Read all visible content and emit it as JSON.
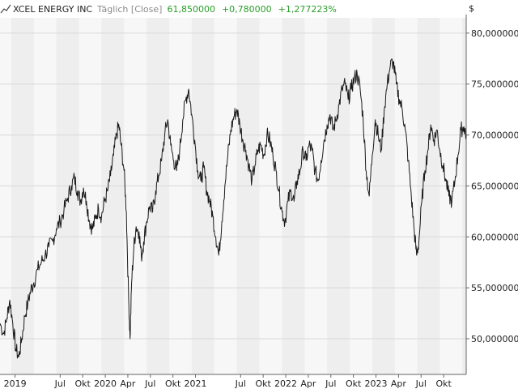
{
  "header": {
    "name": "XCEL ENERGY INC",
    "period": "Täglich [Close]",
    "last": "61,850000",
    "change": "+0,780000",
    "change_pct": "+1,277223%"
  },
  "colors": {
    "line": "#1a1a1a",
    "positive": "#2a9d2a",
    "band_light": "#f7f7f7",
    "band_dark": "#eeeeee",
    "grid": "#d8d8d8"
  },
  "chart_data": {
    "type": "line",
    "currency_label": "$",
    "y_ticks": [
      "80,000000",
      "75,000000",
      "70,000000",
      "65,000000",
      "60,000000",
      "55,000000",
      "50,000000"
    ],
    "y_tick_values": [
      80,
      75,
      70,
      65,
      60,
      55,
      50
    ],
    "ylim": [
      46.5,
      81.5
    ],
    "x_ticks": [
      {
        "label": "2019",
        "t": 0.5
      },
      {
        "label": "Jul",
        "t": 6.5
      },
      {
        "label": "Okt",
        "t": 9.5
      },
      {
        "label": "2020",
        "t": 12.5
      },
      {
        "label": "Apr",
        "t": 15.5
      },
      {
        "label": "Jul",
        "t": 18.5
      },
      {
        "label": "Okt",
        "t": 21.5
      },
      {
        "label": "2021",
        "t": 24.5
      },
      {
        "label": "Jul",
        "t": 30.5
      },
      {
        "label": "Okt",
        "t": 33.5
      },
      {
        "label": "2022",
        "t": 36.5
      },
      {
        "label": "Apr",
        "t": 39.5
      },
      {
        "label": "Jul",
        "t": 42.5
      },
      {
        "label": "Okt",
        "t": 45.5
      },
      {
        "label": "2023",
        "t": 48.5
      },
      {
        "label": "Apr",
        "t": 51.5
      },
      {
        "label": "Jul",
        "t": 54.5
      },
      {
        "label": "Okt",
        "t": 57.5
      }
    ],
    "xlim": [
      -1.5,
      60.5
    ],
    "series": [
      {
        "values": [
          [
            -1.5,
            51.5
          ],
          [
            -1.0,
            50.5
          ],
          [
            -0.6,
            52.0
          ],
          [
            -0.2,
            53.8
          ],
          [
            0.2,
            51.5
          ],
          [
            0.6,
            49.0
          ],
          [
            1.0,
            48.2
          ],
          [
            1.4,
            50.0
          ],
          [
            1.8,
            52.2
          ],
          [
            2.2,
            53.5
          ],
          [
            2.6,
            54.8
          ],
          [
            3.0,
            55.5
          ],
          [
            3.5,
            56.8
          ],
          [
            4.0,
            57.5
          ],
          [
            4.5,
            58.2
          ],
          [
            5.0,
            59.0
          ],
          [
            5.5,
            59.6
          ],
          [
            6.0,
            60.8
          ],
          [
            6.5,
            61.5
          ],
          [
            7.0,
            62.6
          ],
          [
            7.5,
            63.8
          ],
          [
            8.0,
            65.0
          ],
          [
            8.4,
            65.8
          ],
          [
            8.8,
            64.5
          ],
          [
            9.2,
            63.5
          ],
          [
            9.6,
            64.8
          ],
          [
            10.0,
            63.5
          ],
          [
            10.4,
            61.5
          ],
          [
            10.8,
            60.8
          ],
          [
            11.2,
            61.8
          ],
          [
            11.6,
            62.8
          ],
          [
            12.0,
            62.0
          ],
          [
            12.4,
            63.5
          ],
          [
            12.8,
            64.5
          ],
          [
            13.2,
            66.0
          ],
          [
            13.6,
            68.0
          ],
          [
            14.0,
            70.0
          ],
          [
            14.3,
            71.0
          ],
          [
            14.6,
            69.0
          ],
          [
            15.0,
            66.5
          ],
          [
            15.3,
            62.5
          ],
          [
            15.6,
            54.0
          ],
          [
            15.8,
            50.0
          ],
          [
            16.0,
            55.5
          ],
          [
            16.3,
            59.0
          ],
          [
            16.6,
            61.0
          ],
          [
            17.0,
            60.5
          ],
          [
            17.3,
            58.0
          ],
          [
            17.6,
            59.5
          ],
          [
            18.0,
            61.5
          ],
          [
            18.4,
            63.0
          ],
          [
            18.8,
            62.5
          ],
          [
            19.2,
            64.5
          ],
          [
            19.6,
            66.0
          ],
          [
            20.0,
            67.5
          ],
          [
            20.4,
            70.0
          ],
          [
            20.8,
            71.5
          ],
          [
            21.2,
            69.0
          ],
          [
            21.6,
            67.5
          ],
          [
            22.0,
            66.5
          ],
          [
            22.4,
            68.5
          ],
          [
            22.8,
            71.5
          ],
          [
            23.2,
            73.5
          ],
          [
            23.6,
            74.5
          ],
          [
            24.0,
            72.0
          ],
          [
            24.4,
            69.5
          ],
          [
            24.8,
            66.5
          ],
          [
            25.2,
            65.5
          ],
          [
            25.6,
            66.8
          ],
          [
            26.0,
            64.5
          ],
          [
            26.4,
            63.5
          ],
          [
            26.8,
            62.0
          ],
          [
            27.2,
            60.0
          ],
          [
            27.6,
            58.2
          ],
          [
            28.0,
            61.5
          ],
          [
            28.4,
            65.0
          ],
          [
            28.8,
            68.0
          ],
          [
            29.2,
            70.5
          ],
          [
            29.6,
            71.8
          ],
          [
            30.0,
            72.5
          ],
          [
            30.4,
            71.0
          ],
          [
            30.8,
            69.5
          ],
          [
            31.2,
            68.5
          ],
          [
            31.6,
            67.0
          ],
          [
            32.0,
            65.5
          ],
          [
            32.4,
            67.0
          ],
          [
            32.8,
            68.5
          ],
          [
            33.2,
            69.0
          ],
          [
            33.6,
            68.0
          ],
          [
            34.0,
            70.0
          ],
          [
            34.4,
            69.5
          ],
          [
            34.8,
            68.0
          ],
          [
            35.2,
            66.5
          ],
          [
            35.6,
            64.5
          ],
          [
            36.0,
            62.5
          ],
          [
            36.4,
            61.5
          ],
          [
            36.8,
            63.5
          ],
          [
            37.2,
            64.5
          ],
          [
            37.6,
            63.5
          ],
          [
            38.0,
            65.5
          ],
          [
            38.4,
            66.5
          ],
          [
            38.8,
            68.5
          ],
          [
            39.2,
            67.5
          ],
          [
            39.6,
            69.0
          ],
          [
            40.0,
            68.5
          ],
          [
            40.4,
            66.5
          ],
          [
            40.8,
            65.5
          ],
          [
            41.2,
            67.5
          ],
          [
            41.6,
            69.5
          ],
          [
            42.0,
            71.0
          ],
          [
            42.4,
            72.0
          ],
          [
            42.8,
            70.5
          ],
          [
            43.2,
            71.5
          ],
          [
            43.6,
            73.0
          ],
          [
            44.0,
            74.5
          ],
          [
            44.4,
            75.0
          ],
          [
            44.8,
            73.5
          ],
          [
            45.2,
            74.5
          ],
          [
            45.6,
            75.5
          ],
          [
            46.0,
            76.0
          ],
          [
            46.4,
            74.5
          ],
          [
            46.8,
            71.5
          ],
          [
            47.2,
            66.5
          ],
          [
            47.6,
            64.0
          ],
          [
            48.0,
            68.0
          ],
          [
            48.4,
            71.5
          ],
          [
            48.8,
            70.0
          ],
          [
            49.2,
            68.5
          ],
          [
            49.6,
            72.5
          ],
          [
            50.0,
            75.0
          ],
          [
            50.4,
            76.8
          ],
          [
            50.8,
            77.2
          ],
          [
            51.2,
            75.0
          ],
          [
            51.6,
            73.5
          ],
          [
            52.0,
            72.5
          ],
          [
            52.4,
            70.5
          ],
          [
            52.8,
            67.5
          ],
          [
            53.2,
            64.0
          ],
          [
            53.6,
            60.5
          ],
          [
            53.9,
            58.2
          ],
          [
            54.2,
            59.5
          ],
          [
            54.6,
            63.5
          ],
          [
            55.0,
            66.5
          ],
          [
            55.4,
            68.5
          ],
          [
            55.8,
            71.0
          ],
          [
            56.2,
            69.5
          ],
          [
            56.6,
            70.5
          ],
          [
            57.0,
            68.5
          ],
          [
            57.4,
            67.0
          ],
          [
            57.8,
            65.5
          ],
          [
            58.2,
            64.0
          ],
          [
            58.6,
            63.5
          ],
          [
            59.0,
            65.5
          ],
          [
            59.4,
            68.0
          ],
          [
            59.8,
            70.5
          ],
          [
            60.2,
            70.8
          ],
          [
            60.5,
            70.0
          ]
        ]
      }
    ]
  }
}
